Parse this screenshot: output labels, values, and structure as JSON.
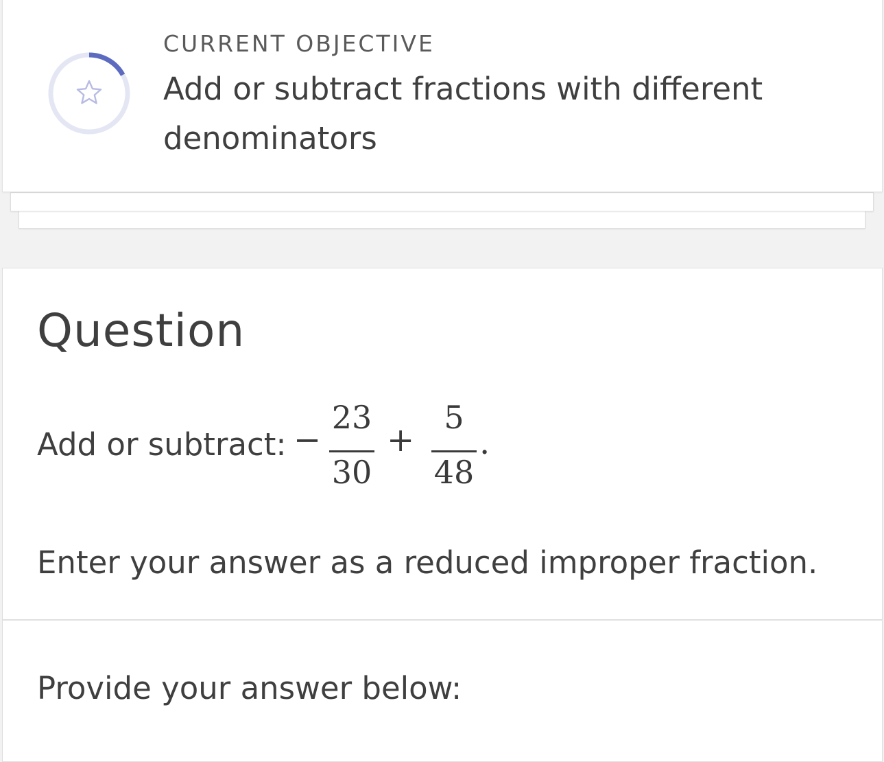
{
  "objective": {
    "label": "CURRENT OBJECTIVE",
    "title": "Add or subtract fractions with different denominators",
    "progress": 0.17,
    "icon": "star-icon",
    "accent_color": "#5c6bc0",
    "track_color": "#e4e6f4"
  },
  "question": {
    "heading": "Question",
    "prompt": "Add or subtract:",
    "expression": {
      "leading_sign": "−",
      "fraction1": {
        "numerator": "23",
        "denominator": "30"
      },
      "operator": "+",
      "fraction2": {
        "numerator": "5",
        "denominator": "48"
      },
      "trailing": "."
    },
    "instruction": "Enter your answer as a reduced improper fraction.",
    "answer_prompt": "Provide your answer below:"
  }
}
